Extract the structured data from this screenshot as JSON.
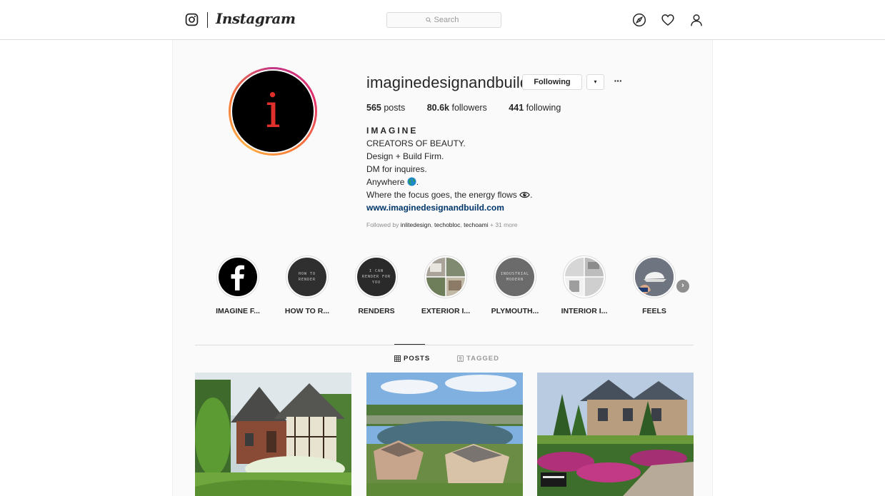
{
  "nav": {
    "brand": "Instagram",
    "search_placeholder": "Search",
    "icons": [
      "instagram-glyph-icon",
      "explore-compass-icon",
      "heart-icon",
      "profile-icon"
    ]
  },
  "profile": {
    "username": "imaginedesignandbuild",
    "following_button": "Following",
    "dropdown_glyph": "▾",
    "more_glyph": "···",
    "avatar_letter": "i",
    "stats": {
      "posts_count": "565",
      "posts_label": "posts",
      "followers_count": "80.6k",
      "followers_label": "followers",
      "following_count": "441",
      "following_label": "following"
    },
    "bio": {
      "name": "IMAGINE",
      "line1": "CREATORS OF BEAUTY.",
      "line2": "Design + Build Firm.",
      "line3": "DM for inquires.",
      "line4": "Anywhere",
      "line5": "Where the focus goes, the energy flows",
      "website": "www.imaginedesignandbuild.com"
    },
    "followed_by": {
      "prefix": "Followed by",
      "users": [
        "inlitedesign",
        "techobloc",
        "techoami"
      ],
      "more": "+ 31 more"
    }
  },
  "highlights": [
    {
      "label": "IMAGINE F...",
      "inner_text": ""
    },
    {
      "label": "HOW TO R...",
      "inner_text": "HOW TO RENDER"
    },
    {
      "label": "RENDERS",
      "inner_text": "I CAN RENDER FOR YOU"
    },
    {
      "label": "EXTERIOR I...",
      "inner_text": ""
    },
    {
      "label": "PLYMOUTH...",
      "inner_text": "INDUSTRIAL MODERN"
    },
    {
      "label": "INTERIOR I...",
      "inner_text": ""
    },
    {
      "label": "FEELS",
      "inner_text": ""
    }
  ],
  "highlights_next_glyph": "›",
  "tabs": {
    "posts": "POSTS",
    "tagged": "TAGGED"
  },
  "colors": {
    "accent_link": "#003569",
    "avatar_bg": "#000000",
    "avatar_letter": "#e0302b",
    "background": "#fafafa"
  }
}
